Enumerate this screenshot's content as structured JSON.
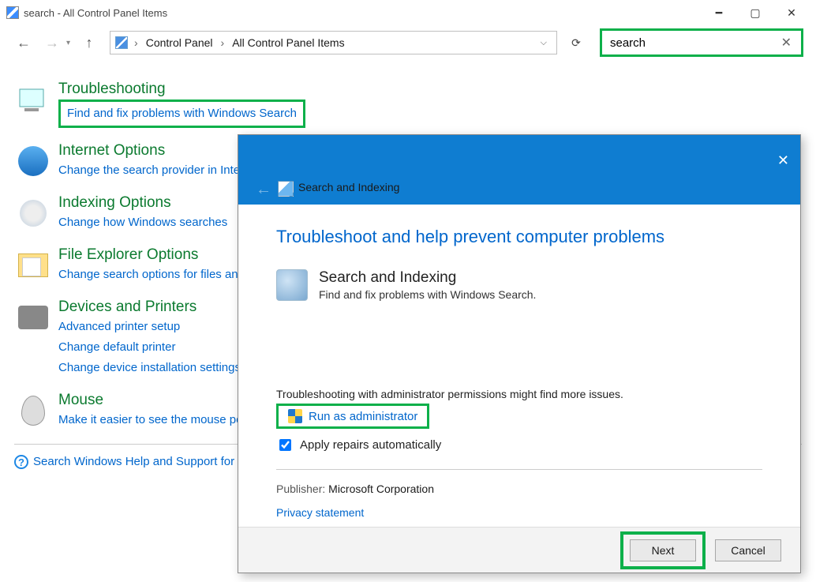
{
  "window": {
    "title": "search - All Control Panel Items"
  },
  "nav": {
    "crumbs": [
      "Control Panel",
      "All Control Panel Items"
    ],
    "search_value": "search"
  },
  "items": [
    {
      "title": "Troubleshooting",
      "links": [
        "Find and fix problems with Windows Search"
      ],
      "highlight_first_link": true
    },
    {
      "title": "Internet Options",
      "links": [
        "Change the search provider in Internet Explorer"
      ]
    },
    {
      "title": "Indexing Options",
      "links": [
        "Change how Windows searches"
      ]
    },
    {
      "title": "File Explorer Options",
      "links": [
        "Change search options for files and folders"
      ]
    },
    {
      "title": "Devices and Printers",
      "links": [
        "Advanced printer setup",
        "Change default printer",
        "Change device installation settings"
      ]
    },
    {
      "title": "Mouse",
      "links": [
        "Make it easier to see the mouse pointer"
      ]
    }
  ],
  "help_link": "Search Windows Help and Support for \"search\"",
  "dialog": {
    "titlebar": "Search and Indexing",
    "heading": "Troubleshoot and help prevent computer problems",
    "item_title": "Search and Indexing",
    "item_sub": "Find and fix problems with Windows Search.",
    "admin_note": "Troubleshooting with administrator permissions might find more issues.",
    "run_admin": "Run as administrator",
    "apply_repairs": "Apply repairs automatically",
    "publisher_label": "Publisher:",
    "publisher_value": "Microsoft Corporation",
    "privacy": "Privacy statement",
    "next": "Next",
    "cancel": "Cancel"
  }
}
